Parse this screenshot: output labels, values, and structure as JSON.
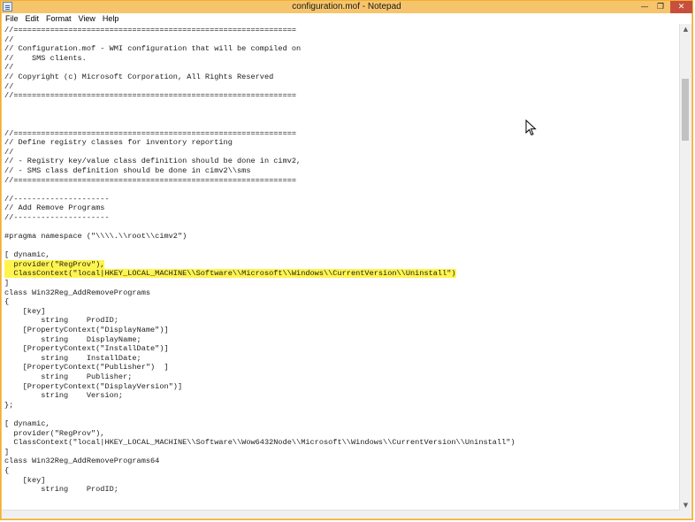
{
  "window": {
    "title": "configuration.mof - Notepad",
    "min_glyph": "—",
    "max_glyph": "❐",
    "close_glyph": "✕",
    "icons": [
      "notepad-icon",
      "minimize-icon",
      "restore-icon",
      "close-icon",
      "mouse-pointer-icon"
    ]
  },
  "menu": {
    "file": "File",
    "edit": "Edit",
    "format": "Format",
    "view": "View",
    "help": "Help"
  },
  "scrollbar": {
    "up_glyph": "▲",
    "down_glyph": "▼"
  },
  "colors": {
    "title_bar": "#f6c46c",
    "close_button": "#c7503d",
    "highlight": "#fff44f"
  },
  "document": {
    "highlighted_lines": [
      25,
      26
    ],
    "lines": [
      "//==============================================================",
      "//",
      "// Configuration.mof - WMI configuration that will be compiled on",
      "//    SMS clients.",
      "//",
      "// Copyright (c) Microsoft Corporation, All Rights Reserved",
      "//",
      "//==============================================================",
      "",
      "",
      "",
      "//==============================================================",
      "// Define registry classes for inventory reporting",
      "//",
      "// - Registry key/value class definition should be done in cimv2,",
      "// - SMS class definition should be done in cimv2\\\\sms",
      "//==============================================================",
      "",
      "//---------------------",
      "// Add Remove Programs",
      "//---------------------",
      "",
      "#pragma namespace (\"\\\\\\\\.\\\\root\\\\cimv2\")",
      "",
      "[ dynamic,",
      "  provider(\"RegProv\"),",
      "  ClassContext(\"local|HKEY_LOCAL_MACHINE\\\\Software\\\\Microsoft\\\\Windows\\\\CurrentVersion\\\\Uninstall\")",
      "]",
      "class Win32Reg_AddRemovePrograms",
      "{",
      "    [key]",
      "        string    ProdID;",
      "    [PropertyContext(\"DisplayName\")]",
      "        string    DisplayName;",
      "    [PropertyContext(\"InstallDate\")]",
      "        string    InstallDate;",
      "    [PropertyContext(\"Publisher\")  ]",
      "        string    Publisher;",
      "    [PropertyContext(\"DisplayVersion\")]",
      "        string    Version;",
      "};",
      "",
      "[ dynamic,",
      "  provider(\"RegProv\"),",
      "  ClassContext(\"local|HKEY_LOCAL_MACHINE\\\\Software\\\\Wow6432Node\\\\Microsoft\\\\Windows\\\\CurrentVersion\\\\Uninstall\")",
      "]",
      "class Win32Reg_AddRemovePrograms64",
      "{",
      "    [key]",
      "        string    ProdID;"
    ]
  }
}
